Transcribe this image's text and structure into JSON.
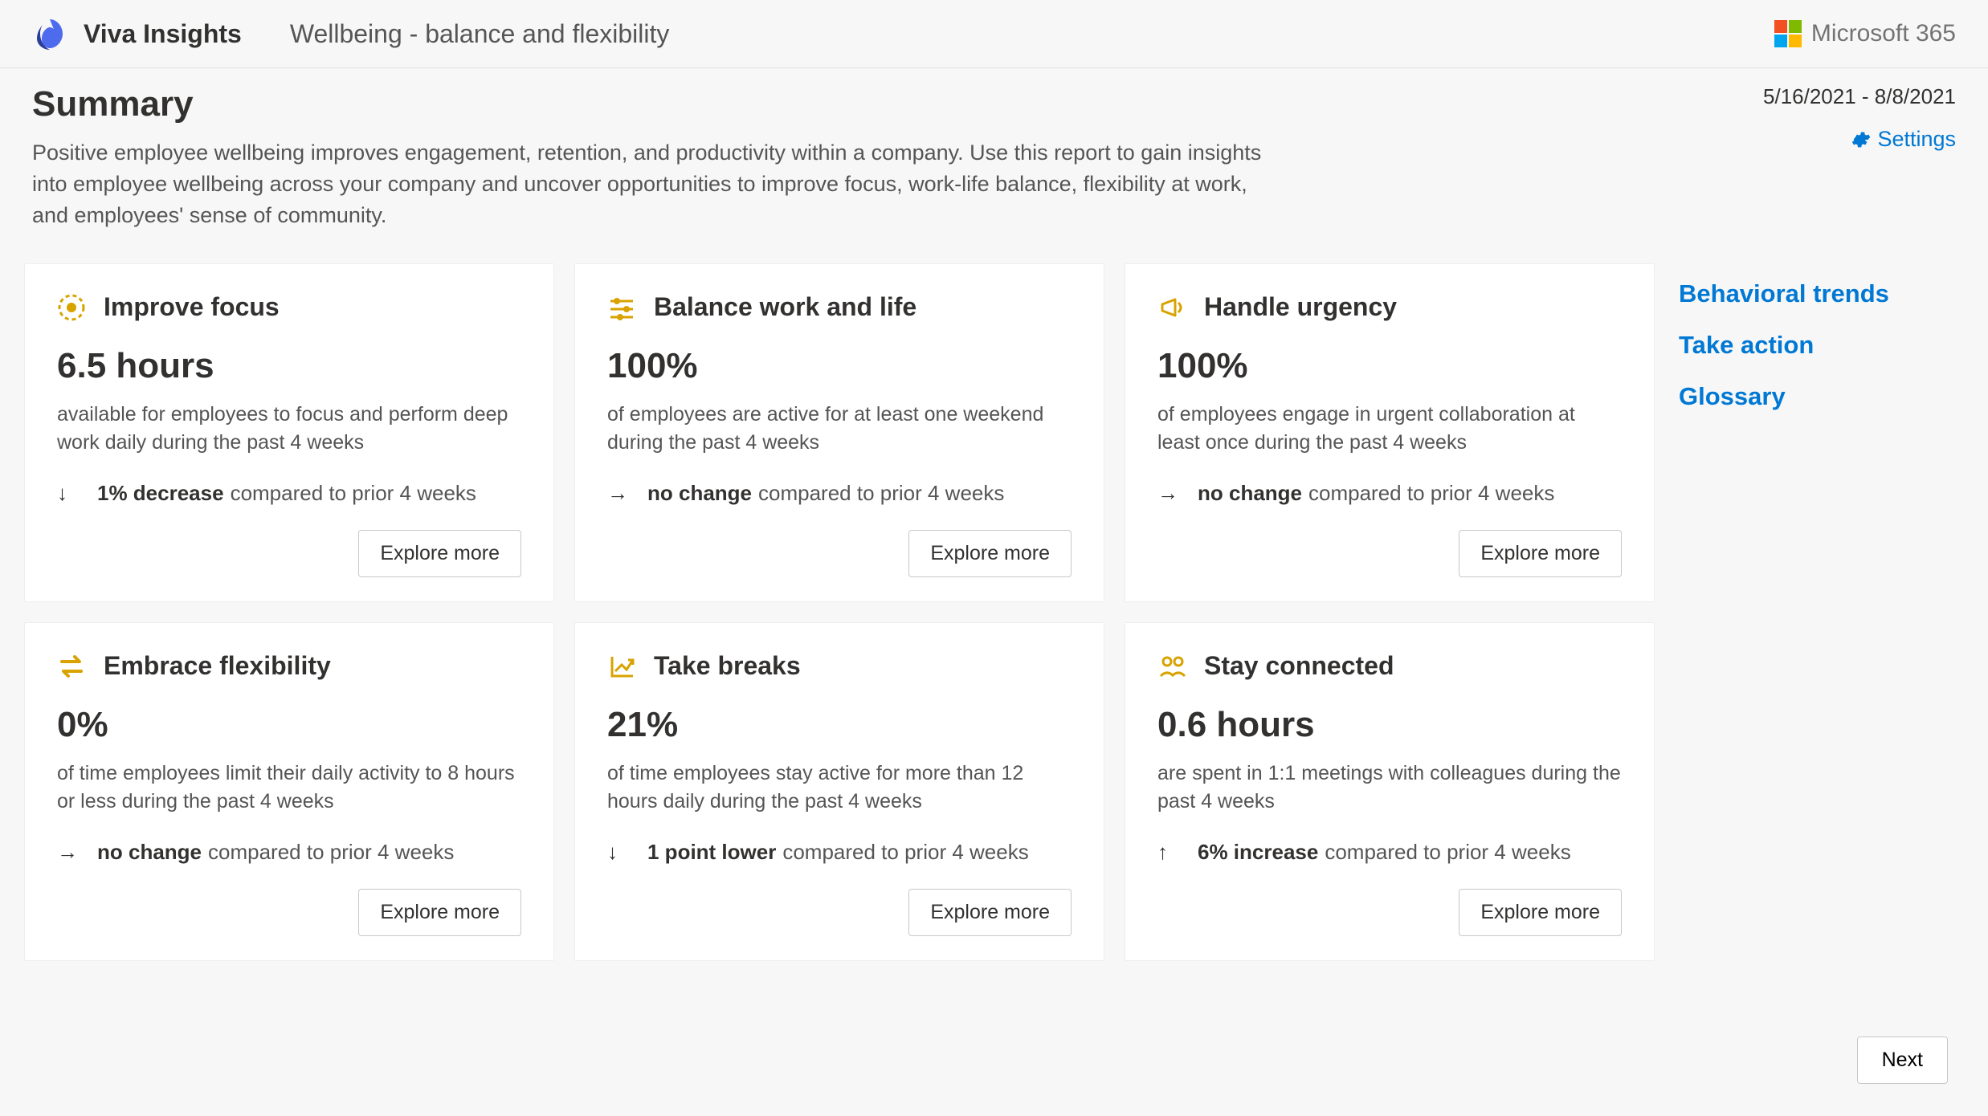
{
  "header": {
    "app_title": "Viva Insights",
    "page_title": "Wellbeing - balance and flexibility",
    "ms365_label": "Microsoft 365"
  },
  "summary": {
    "title": "Summary",
    "description": "Positive employee wellbeing improves engagement, retention, and productivity within a company. Use this report to gain insights into employee wellbeing across your company and uncover opportunities to improve focus, work-life balance, flexibility at work, and employees' sense of community.",
    "date_range": "5/16/2021 - 8/8/2021",
    "settings_label": "Settings"
  },
  "cards": [
    {
      "title": "Improve focus",
      "metric": "6.5 hours",
      "desc": "available for employees to focus and perform deep work daily during the past 4 weeks",
      "trend_arrow": "↓",
      "trend_change": "1% decrease",
      "trend_tail": "compared to prior 4 weeks",
      "button": "Explore more",
      "icon": "target"
    },
    {
      "title": "Balance work and life",
      "metric": "100%",
      "desc": "of employees are active for at least one weekend during the past 4 weeks",
      "trend_arrow": "→",
      "trend_change": "no change",
      "trend_tail": "compared to prior 4 weeks",
      "button": "Explore more",
      "icon": "sliders"
    },
    {
      "title": "Handle urgency",
      "metric": "100%",
      "desc": "of employees engage in urgent collaboration at least once during the past 4 weeks",
      "trend_arrow": "→",
      "trend_change": "no change",
      "trend_tail": "compared to prior 4 weeks",
      "button": "Explore more",
      "icon": "megaphone"
    },
    {
      "title": "Embrace flexibility",
      "metric": "0%",
      "desc": "of time employees limit their daily activity to 8 hours or less during the past 4 weeks",
      "trend_arrow": "→",
      "trend_change": "no change",
      "trend_tail": "compared to prior 4 weeks",
      "button": "Explore more",
      "icon": "swap"
    },
    {
      "title": "Take breaks",
      "metric": "21%",
      "desc": "of time employees stay active for more than 12 hours daily during the past 4 weeks",
      "trend_arrow": "↓",
      "trend_change": "1 point lower",
      "trend_tail": "compared to prior 4 weeks",
      "button": "Explore more",
      "icon": "chart"
    },
    {
      "title": "Stay connected",
      "metric": "0.6 hours",
      "desc": "are spent in 1:1 meetings with colleagues during the past 4 weeks",
      "trend_arrow": "↑",
      "trend_change": "6% increase",
      "trend_tail": "compared to prior 4 weeks",
      "button": "Explore more",
      "icon": "people"
    }
  ],
  "right_nav": [
    "Behavioral trends",
    "Take action",
    "Glossary"
  ],
  "footer": {
    "next_label": "Next"
  }
}
